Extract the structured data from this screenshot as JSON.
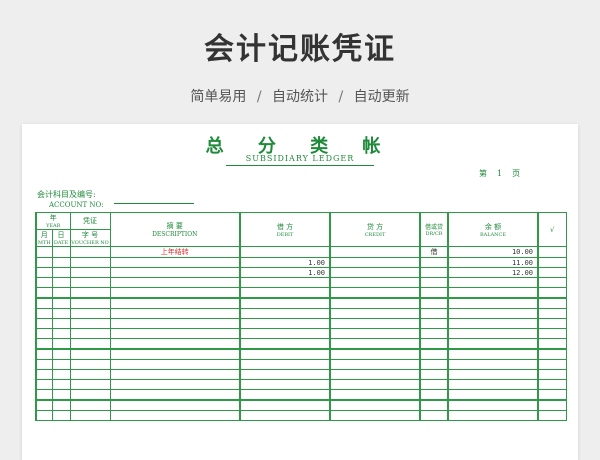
{
  "header": {
    "title": "会计记账凭证",
    "subtitle_parts": [
      "简单易用",
      "自动统计",
      "自动更新"
    ],
    "separator": "/"
  },
  "ledger": {
    "title": "总 分 类 帐",
    "subtitle": "SUBSIDIARY LEDGER",
    "page_prefix": "第",
    "page_number": "1",
    "page_suffix": "页",
    "account_label": "会计科目及编号:",
    "account_label_en": "ACCOUNT NO:"
  },
  "columns": {
    "year": "年",
    "year_en": "YEAR",
    "month": "月",
    "month_en": "MTH",
    "day": "日",
    "day_en": "DATE",
    "voucher": "凭证",
    "voucher_no": "字 号",
    "voucher_en": "VOUCHER NO",
    "description": "摘    要",
    "description_en": "DESCRIPTION",
    "debit": "借 方",
    "debit_en": "DEBIT",
    "credit": "贷 方",
    "credit_en": "CREDIT",
    "dc": "借或贷",
    "dc_en": "DR/CR",
    "balance": "余 额",
    "balance_en": "BALANCE",
    "check": "√"
  },
  "rows": [
    {
      "description": "上年结转",
      "debit": "",
      "dc": "借",
      "balance": "10.00"
    },
    {
      "description": "",
      "debit": "1.00",
      "dc": "",
      "balance": "11.00"
    },
    {
      "description": "",
      "debit": "1.00",
      "dc": "",
      "balance": "12.00"
    }
  ],
  "empty_rows": 14
}
